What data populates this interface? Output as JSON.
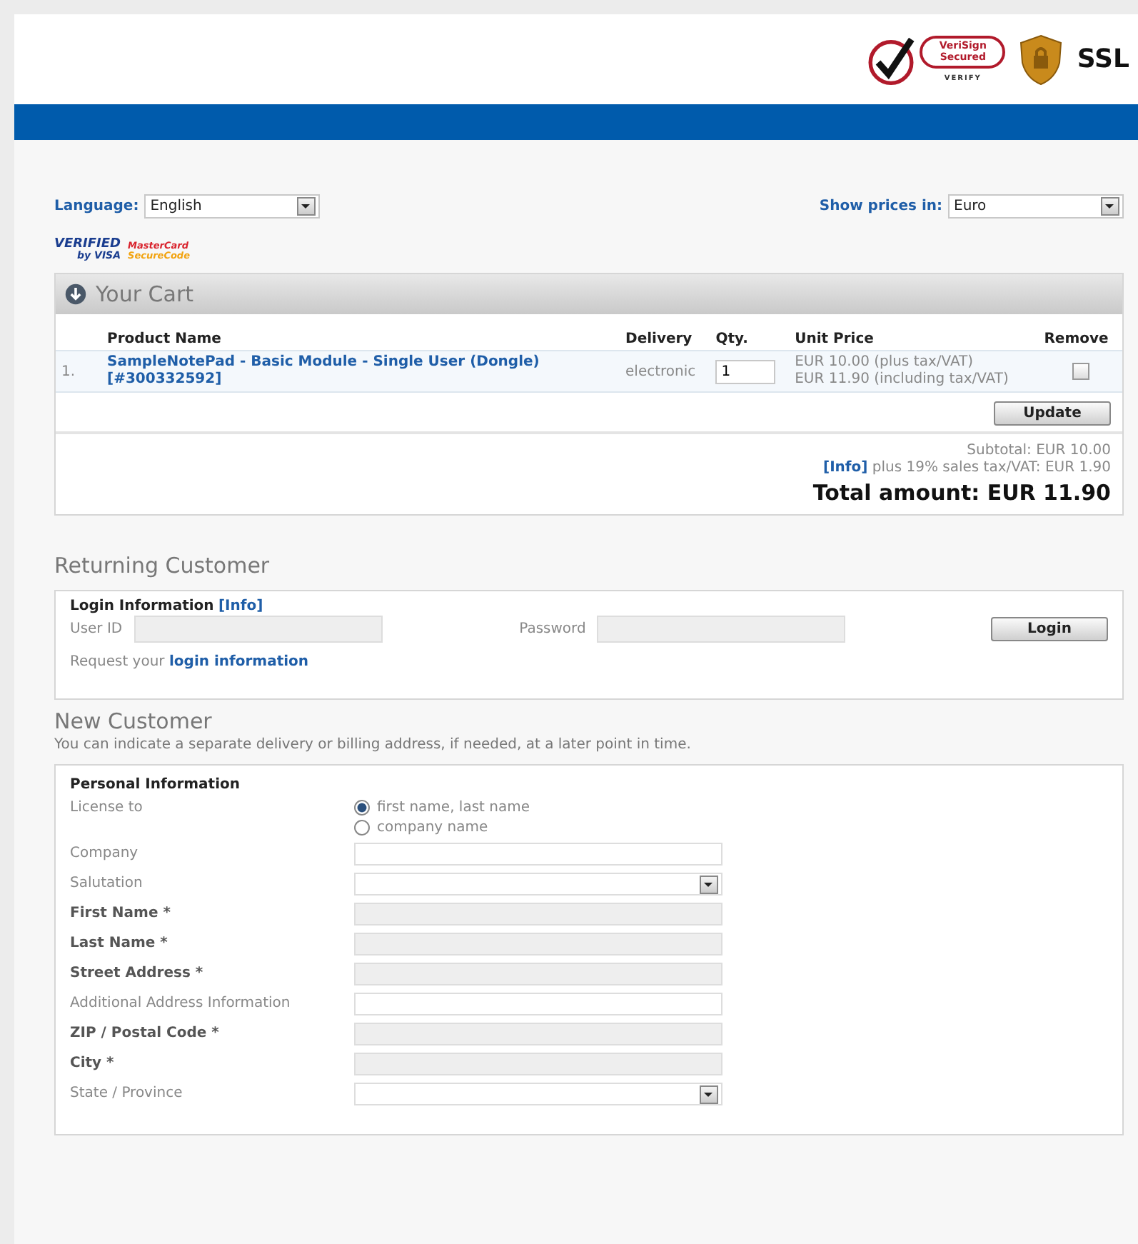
{
  "header": {
    "verisign": {
      "title": "VeriSign Secured",
      "sub": "VERIFY"
    },
    "ssl": {
      "title": "SSL"
    }
  },
  "language": {
    "label": "Language:",
    "value": "English"
  },
  "currency": {
    "label": "Show prices in:",
    "value": "Euro"
  },
  "card_logos": {
    "visa": {
      "line1": "VERIFIED",
      "line2": "by VISA"
    },
    "mastercard": {
      "line1": "MasterCard",
      "line2": "SecureCode"
    }
  },
  "cart": {
    "title": "Your Cart",
    "columns": [
      "Product Name",
      "Delivery",
      "Qty.",
      "Unit Price",
      "Remove"
    ],
    "rows": [
      {
        "index": "1.",
        "product": "SampleNotePad - Basic Module - Single User (Dongle) [#300332592]",
        "delivery": "electronic",
        "qty": "1",
        "price_net": "EUR 10.00 (plus tax/VAT)",
        "price_gross": "EUR 11.90 (including tax/VAT)",
        "remove": false
      }
    ],
    "update_button": "Update",
    "subtotal": "Subtotal: EUR 10.00",
    "tax_link": "[Info]",
    "tax": "plus 19% sales tax/VAT: EUR 1.90",
    "total": "Total amount: EUR 11.90"
  },
  "returning": {
    "heading": "Returning Customer",
    "box_title": "Login Information",
    "info_link": "[Info]",
    "user_label": "User ID",
    "password_label": "Password",
    "login_button": "Login",
    "request_text": "Request your",
    "request_link": "login information"
  },
  "new_customer": {
    "heading": "New Customer",
    "note": "You can indicate a separate delivery or billing address, if needed, at a later point in time.",
    "box_title": "Personal Information",
    "license_label": "License to",
    "license_options": [
      {
        "label": "first name, last name",
        "selected": true
      },
      {
        "label": "company name",
        "selected": false
      }
    ],
    "fields": [
      {
        "label": "Company",
        "kind": "text",
        "required": false
      },
      {
        "label": "Salutation",
        "kind": "select",
        "required": false
      },
      {
        "label": "First Name *",
        "kind": "text",
        "required": true
      },
      {
        "label": "Last Name *",
        "kind": "text",
        "required": true
      },
      {
        "label": "Street Address *",
        "kind": "text",
        "required": true
      },
      {
        "label": "Additional Address Information",
        "kind": "text",
        "required": false
      },
      {
        "label": "ZIP / Postal Code *",
        "kind": "text",
        "required": true
      },
      {
        "label": "City *",
        "kind": "text",
        "required": true
      },
      {
        "label": "State / Province",
        "kind": "select",
        "required": false
      }
    ]
  }
}
